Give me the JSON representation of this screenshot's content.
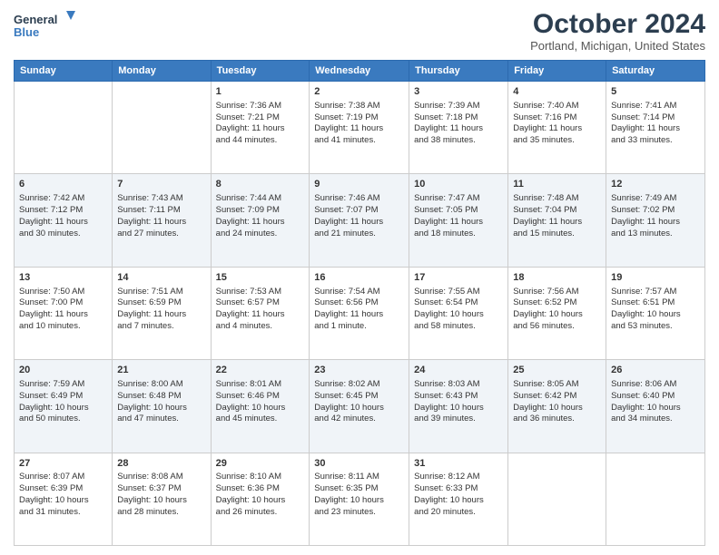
{
  "logo": {
    "line1": "General",
    "line2": "Blue"
  },
  "title": "October 2024",
  "location": "Portland, Michigan, United States",
  "headers": [
    "Sunday",
    "Monday",
    "Tuesday",
    "Wednesday",
    "Thursday",
    "Friday",
    "Saturday"
  ],
  "weeks": [
    [
      {
        "day": "",
        "info": ""
      },
      {
        "day": "",
        "info": ""
      },
      {
        "day": "1",
        "info": "Sunrise: 7:36 AM\nSunset: 7:21 PM\nDaylight: 11 hours\nand 44 minutes."
      },
      {
        "day": "2",
        "info": "Sunrise: 7:38 AM\nSunset: 7:19 PM\nDaylight: 11 hours\nand 41 minutes."
      },
      {
        "day": "3",
        "info": "Sunrise: 7:39 AM\nSunset: 7:18 PM\nDaylight: 11 hours\nand 38 minutes."
      },
      {
        "day": "4",
        "info": "Sunrise: 7:40 AM\nSunset: 7:16 PM\nDaylight: 11 hours\nand 35 minutes."
      },
      {
        "day": "5",
        "info": "Sunrise: 7:41 AM\nSunset: 7:14 PM\nDaylight: 11 hours\nand 33 minutes."
      }
    ],
    [
      {
        "day": "6",
        "info": "Sunrise: 7:42 AM\nSunset: 7:12 PM\nDaylight: 11 hours\nand 30 minutes."
      },
      {
        "day": "7",
        "info": "Sunrise: 7:43 AM\nSunset: 7:11 PM\nDaylight: 11 hours\nand 27 minutes."
      },
      {
        "day": "8",
        "info": "Sunrise: 7:44 AM\nSunset: 7:09 PM\nDaylight: 11 hours\nand 24 minutes."
      },
      {
        "day": "9",
        "info": "Sunrise: 7:46 AM\nSunset: 7:07 PM\nDaylight: 11 hours\nand 21 minutes."
      },
      {
        "day": "10",
        "info": "Sunrise: 7:47 AM\nSunset: 7:05 PM\nDaylight: 11 hours\nand 18 minutes."
      },
      {
        "day": "11",
        "info": "Sunrise: 7:48 AM\nSunset: 7:04 PM\nDaylight: 11 hours\nand 15 minutes."
      },
      {
        "day": "12",
        "info": "Sunrise: 7:49 AM\nSunset: 7:02 PM\nDaylight: 11 hours\nand 13 minutes."
      }
    ],
    [
      {
        "day": "13",
        "info": "Sunrise: 7:50 AM\nSunset: 7:00 PM\nDaylight: 11 hours\nand 10 minutes."
      },
      {
        "day": "14",
        "info": "Sunrise: 7:51 AM\nSunset: 6:59 PM\nDaylight: 11 hours\nand 7 minutes."
      },
      {
        "day": "15",
        "info": "Sunrise: 7:53 AM\nSunset: 6:57 PM\nDaylight: 11 hours\nand 4 minutes."
      },
      {
        "day": "16",
        "info": "Sunrise: 7:54 AM\nSunset: 6:56 PM\nDaylight: 11 hours\nand 1 minute."
      },
      {
        "day": "17",
        "info": "Sunrise: 7:55 AM\nSunset: 6:54 PM\nDaylight: 10 hours\nand 58 minutes."
      },
      {
        "day": "18",
        "info": "Sunrise: 7:56 AM\nSunset: 6:52 PM\nDaylight: 10 hours\nand 56 minutes."
      },
      {
        "day": "19",
        "info": "Sunrise: 7:57 AM\nSunset: 6:51 PM\nDaylight: 10 hours\nand 53 minutes."
      }
    ],
    [
      {
        "day": "20",
        "info": "Sunrise: 7:59 AM\nSunset: 6:49 PM\nDaylight: 10 hours\nand 50 minutes."
      },
      {
        "day": "21",
        "info": "Sunrise: 8:00 AM\nSunset: 6:48 PM\nDaylight: 10 hours\nand 47 minutes."
      },
      {
        "day": "22",
        "info": "Sunrise: 8:01 AM\nSunset: 6:46 PM\nDaylight: 10 hours\nand 45 minutes."
      },
      {
        "day": "23",
        "info": "Sunrise: 8:02 AM\nSunset: 6:45 PM\nDaylight: 10 hours\nand 42 minutes."
      },
      {
        "day": "24",
        "info": "Sunrise: 8:03 AM\nSunset: 6:43 PM\nDaylight: 10 hours\nand 39 minutes."
      },
      {
        "day": "25",
        "info": "Sunrise: 8:05 AM\nSunset: 6:42 PM\nDaylight: 10 hours\nand 36 minutes."
      },
      {
        "day": "26",
        "info": "Sunrise: 8:06 AM\nSunset: 6:40 PM\nDaylight: 10 hours\nand 34 minutes."
      }
    ],
    [
      {
        "day": "27",
        "info": "Sunrise: 8:07 AM\nSunset: 6:39 PM\nDaylight: 10 hours\nand 31 minutes."
      },
      {
        "day": "28",
        "info": "Sunrise: 8:08 AM\nSunset: 6:37 PM\nDaylight: 10 hours\nand 28 minutes."
      },
      {
        "day": "29",
        "info": "Sunrise: 8:10 AM\nSunset: 6:36 PM\nDaylight: 10 hours\nand 26 minutes."
      },
      {
        "day": "30",
        "info": "Sunrise: 8:11 AM\nSunset: 6:35 PM\nDaylight: 10 hours\nand 23 minutes."
      },
      {
        "day": "31",
        "info": "Sunrise: 8:12 AM\nSunset: 6:33 PM\nDaylight: 10 hours\nand 20 minutes."
      },
      {
        "day": "",
        "info": ""
      },
      {
        "day": "",
        "info": ""
      }
    ]
  ]
}
